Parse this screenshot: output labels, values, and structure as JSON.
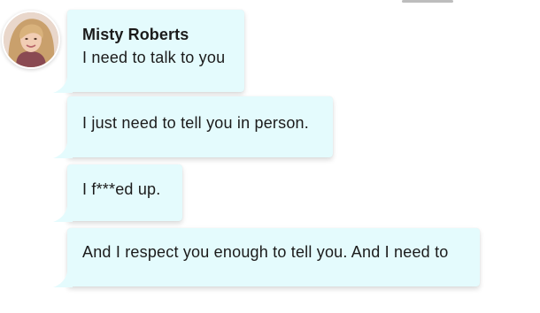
{
  "contact": {
    "name": "Misty Roberts"
  },
  "messages": [
    {
      "text": "I need to talk to you"
    },
    {
      "text": "I just need to tell you in person."
    },
    {
      "text": "I f***ed up."
    },
    {
      "text": "And I respect you enough to tell you. And I need to"
    }
  ],
  "colors": {
    "bubble": "#e4fbfd",
    "text": "#1b1b1b",
    "background": "#ffffff"
  },
  "icons": {
    "avatar": "avatar-photo"
  }
}
